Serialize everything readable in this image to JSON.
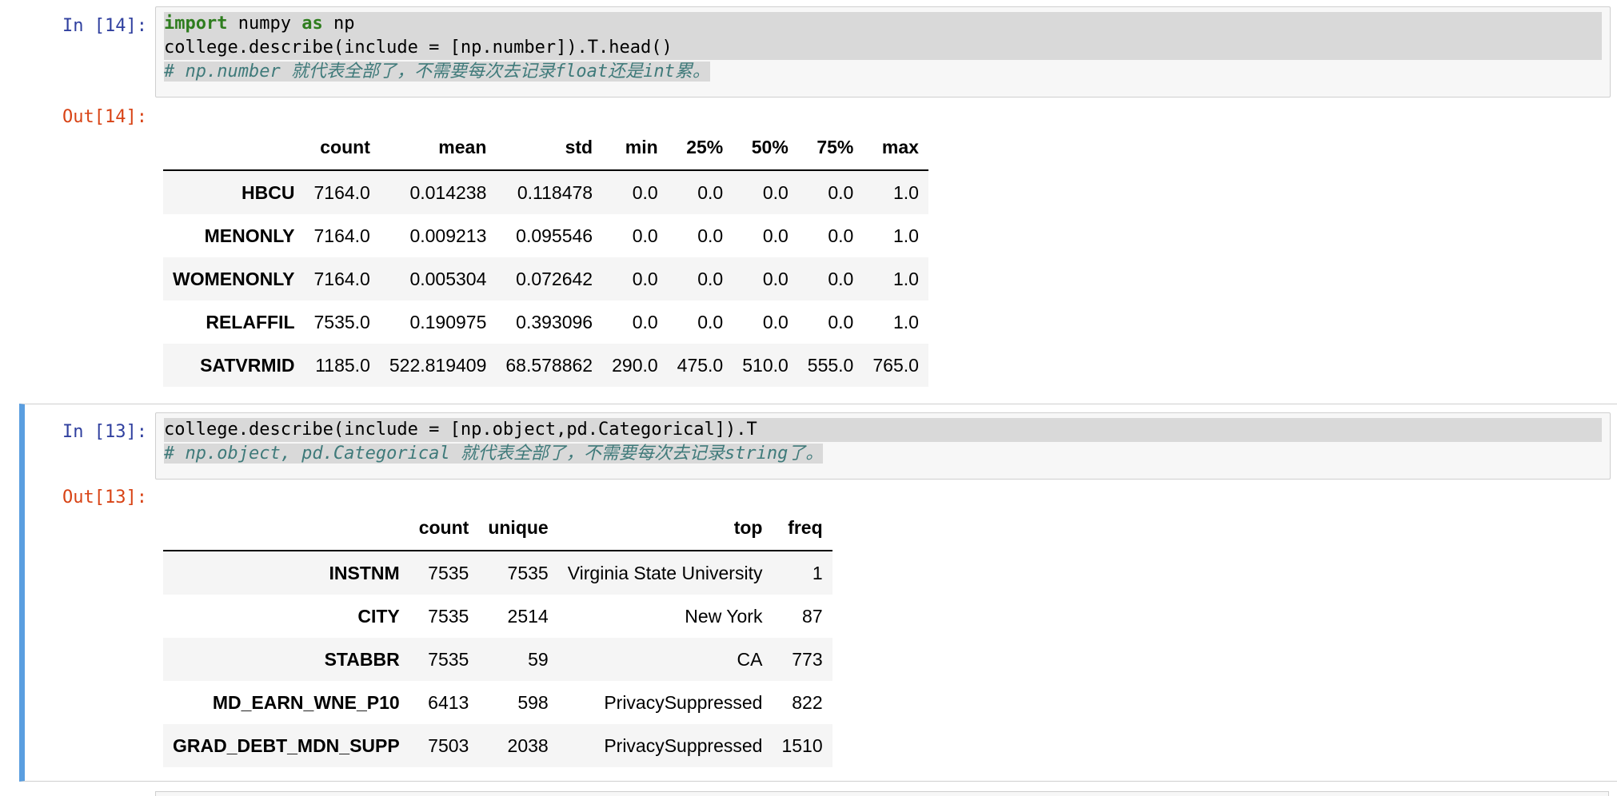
{
  "cells": [
    {
      "in_prompt": "In [14]:",
      "out_prompt": "Out[14]:",
      "code": {
        "line1_kw1": "import",
        "line1_mid": " numpy ",
        "line1_kw2": "as",
        "line1_end": " np",
        "line2": "college.describe(include = [np.number]).T.head()",
        "line3": "# np.number 就代表全部了，不需要每次去记录float还是int累。"
      },
      "table": {
        "columns": [
          "",
          "count",
          "mean",
          "std",
          "min",
          "25%",
          "50%",
          "75%",
          "max"
        ],
        "rows": [
          {
            "index": "HBCU",
            "values": [
              "7164.0",
              "0.014238",
              "0.118478",
              "0.0",
              "0.0",
              "0.0",
              "0.0",
              "1.0"
            ]
          },
          {
            "index": "MENONLY",
            "values": [
              "7164.0",
              "0.009213",
              "0.095546",
              "0.0",
              "0.0",
              "0.0",
              "0.0",
              "1.0"
            ]
          },
          {
            "index": "WOMENONLY",
            "values": [
              "7164.0",
              "0.005304",
              "0.072642",
              "0.0",
              "0.0",
              "0.0",
              "0.0",
              "1.0"
            ]
          },
          {
            "index": "RELAFFIL",
            "values": [
              "7535.0",
              "0.190975",
              "0.393096",
              "0.0",
              "0.0",
              "0.0",
              "0.0",
              "1.0"
            ]
          },
          {
            "index": "SATVRMID",
            "values": [
              "1185.0",
              "522.819409",
              "68.578862",
              "290.0",
              "475.0",
              "510.0",
              "555.0",
              "765.0"
            ]
          }
        ]
      }
    },
    {
      "in_prompt": "In [13]:",
      "out_prompt": "Out[13]:",
      "code": {
        "line1": "college.describe(include = [np.object,pd.Categorical]).T",
        "line2": "# np.object, pd.Categorical 就代表全部了，不需要每次去记录string了。"
      },
      "table": {
        "columns": [
          "",
          "count",
          "unique",
          "top",
          "freq"
        ],
        "rows": [
          {
            "index": "INSTNM",
            "values": [
              "7535",
              "7535",
              "Virginia State University",
              "1"
            ]
          },
          {
            "index": "CITY",
            "values": [
              "7535",
              "2514",
              "New York",
              "87"
            ]
          },
          {
            "index": "STABBR",
            "values": [
              "7535",
              "59",
              "CA",
              "773"
            ]
          },
          {
            "index": "MD_EARN_WNE_P10",
            "values": [
              "6413",
              "598",
              "PrivacySuppressed",
              "822"
            ]
          },
          {
            "index": "GRAD_DEBT_MDN_SUPP",
            "values": [
              "7503",
              "2038",
              "PrivacySuppressed",
              "1510"
            ]
          }
        ]
      }
    }
  ]
}
